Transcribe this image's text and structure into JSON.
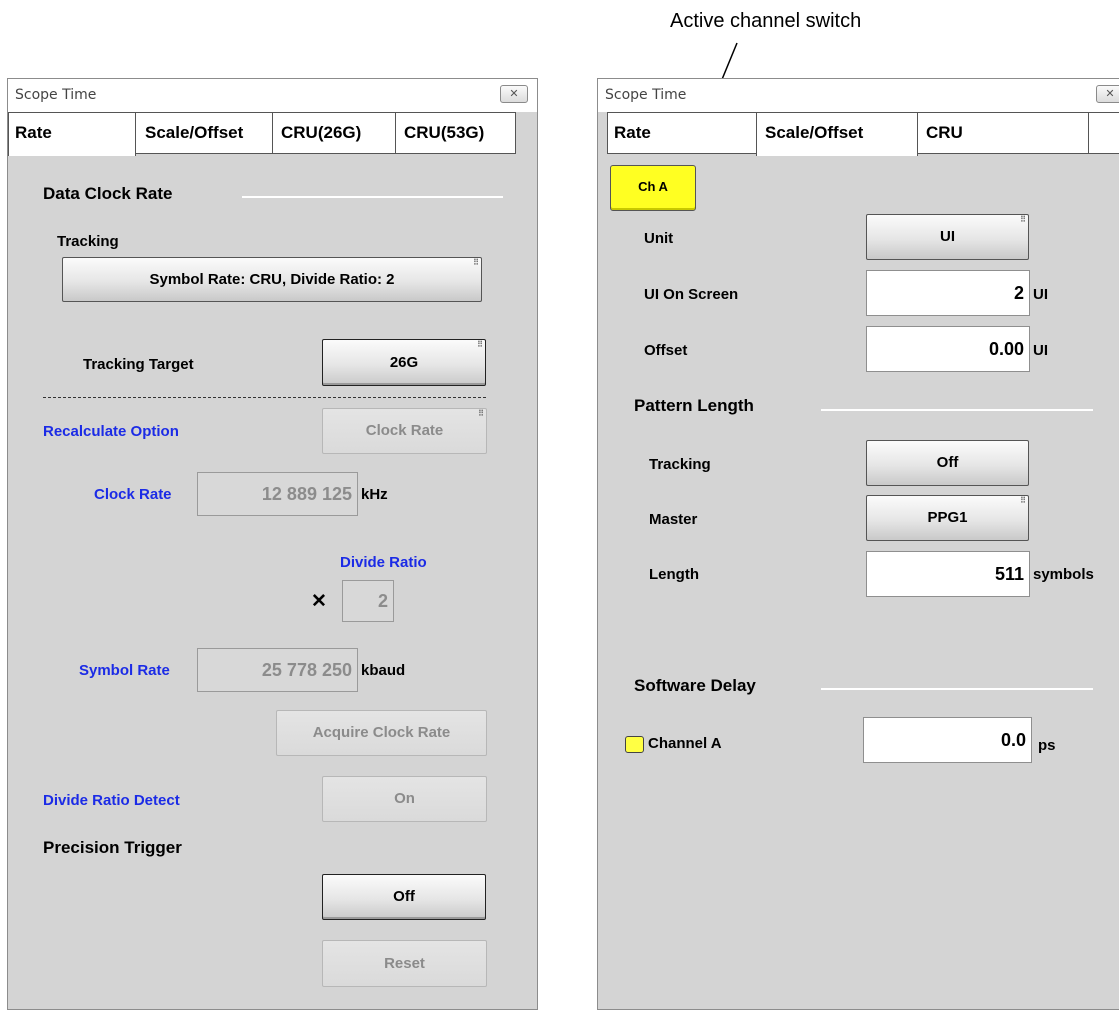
{
  "annotation": {
    "text": "Active channel switch"
  },
  "left": {
    "title": "Scope Time",
    "tabs": [
      "Rate",
      "Scale/Offset",
      "CRU(26G)",
      "CRU(53G)"
    ],
    "data_clock_rate": "Data Clock Rate",
    "tracking_label": "Tracking",
    "tracking_value": "Symbol Rate: CRU, Divide Ratio: 2",
    "tracking_target_label": "Tracking Target",
    "tracking_target_value": "26G",
    "recalculate_label": "Recalculate Option",
    "recalculate_value": "Clock Rate",
    "clock_rate_label": "Clock Rate",
    "clock_rate_value": "12 889 125",
    "clock_rate_unit": "kHz",
    "divide_ratio_label": "Divide Ratio",
    "multiply_sign": "✕",
    "divide_ratio_value": "2",
    "symbol_rate_label": "Symbol Rate",
    "symbol_rate_value": "25 778 250",
    "symbol_rate_unit": "kbaud",
    "acquire_button": "Acquire Clock Rate",
    "divide_detect_label": "Divide Ratio Detect",
    "divide_detect_value": "On",
    "precision_trigger": "Precision Trigger",
    "precision_value": "Off",
    "reset_button": "Reset"
  },
  "right": {
    "title": "Scope Time",
    "tabs": [
      "Rate",
      "Scale/Offset",
      "CRU"
    ],
    "channel_button": "Ch A",
    "unit_label": "Unit",
    "unit_value": "UI",
    "ui_on_screen_label": "UI On Screen",
    "ui_on_screen_value": "2",
    "ui_on_screen_unit": "UI",
    "offset_label": "Offset",
    "offset_value": "0.00",
    "offset_unit": "UI",
    "pattern_length": "Pattern Length",
    "pl_tracking_label": "Tracking",
    "pl_tracking_value": "Off",
    "master_label": "Master",
    "master_value": "PPG1",
    "length_label": "Length",
    "length_value": "511",
    "length_unit": "symbols",
    "software_delay": "Software Delay",
    "channel_a_label": "Channel A",
    "channel_a_value": "0.0",
    "channel_a_unit": "ps"
  },
  "colors": {
    "panel_bg": "#d4d4d4",
    "blue_label": "#1b2be6",
    "channel_yellow": "#ffff22"
  }
}
